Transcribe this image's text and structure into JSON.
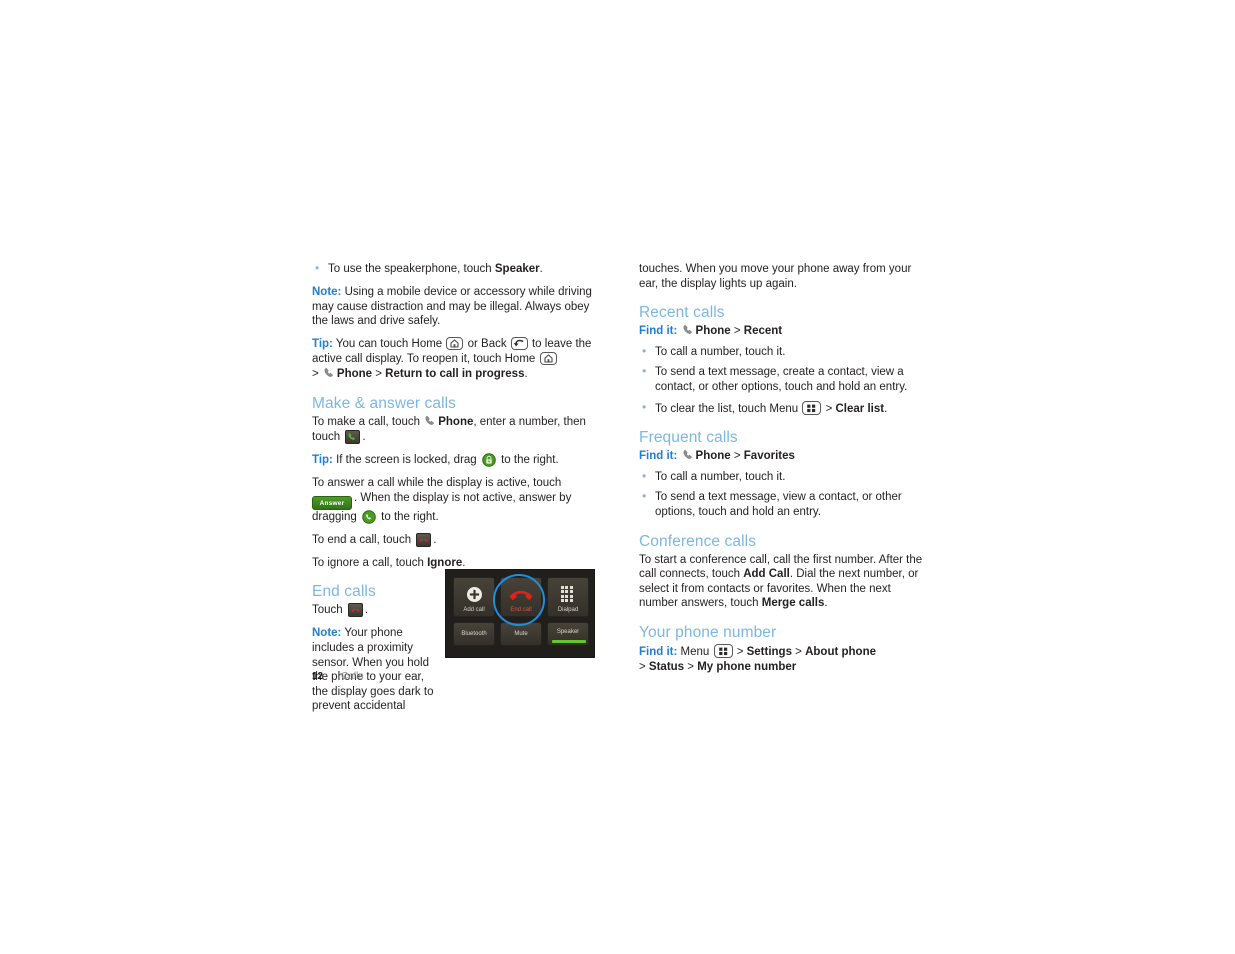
{
  "document": {
    "page_number": "12",
    "section_name": "Calls",
    "accent_heading_color": "#7cb7e2",
    "accent_label_color": "#1f7fd0"
  },
  "left_column": {
    "bullet_speakerphone": {
      "pre": "To use the speakerphone, touch ",
      "bold": "Speaker",
      "post": "."
    },
    "note_driving": {
      "label": "Note:",
      "text": " Using a mobile device or accessory while driving may cause distraction and may be illegal. Always obey the laws and drive safely."
    },
    "tip_home_back": {
      "label": "Tip:",
      "t1": " You can touch Home ",
      "t2": " or Back ",
      "t3": " to leave the active call display. To reopen it, touch Home ",
      "t4": "> ",
      "bold_phone": "Phone",
      "gt": " > ",
      "bold_return": "Return to call in progress",
      "period": "."
    },
    "heading_make_answer": "Make & answer calls",
    "make_call": {
      "pre": "To make a call, touch ",
      "bold_phone": "Phone",
      "mid": ", enter a number, then touch ",
      "post": "."
    },
    "tip_locked": {
      "label": "Tip:",
      "pre": " If the screen is locked, drag ",
      "post": " to the right."
    },
    "answer_call": {
      "pre": "To answer a call while the display is active, touch ",
      "answer_button_label": "Answer",
      "mid": ". When the display is not active, answer by dragging ",
      "post": " to the right."
    },
    "end_call_line": {
      "pre": "To end a call, touch ",
      "post": "."
    },
    "ignore_call_line": {
      "pre": "To ignore a call, touch ",
      "bold": "Ignore",
      "post": "."
    },
    "heading_end_calls": "End calls",
    "touch_line": {
      "pre": "Touch ",
      "post": "."
    },
    "note_proximity": {
      "label": "Note:",
      "text": " Your phone includes a proximity sensor. When you hold the phone to your ear, the display goes dark to prevent accidental"
    }
  },
  "phone_screenshot": {
    "buttons": [
      {
        "name": "add-call",
        "label": "Add call"
      },
      {
        "name": "end-call",
        "label": "End call"
      },
      {
        "name": "dialpad",
        "label": "Dialpad"
      },
      {
        "name": "bluetooth",
        "label": "Bluetooth"
      },
      {
        "name": "mute",
        "label": "Mute"
      },
      {
        "name": "speaker",
        "label": "Speaker"
      }
    ],
    "highlighted_button": "End call",
    "highlight_color": "#1e8fe0",
    "active_indicator_button": "Speaker",
    "active_indicator_color": "#6ac62e",
    "end_call_glyph_color": "#d8282a"
  },
  "right_column": {
    "continued_text": "touches. When you move your phone away from your ear, the display lights up again.",
    "recent_calls": {
      "heading": "Recent calls",
      "findit_label": "Find it:",
      "findit_bold1": "Phone",
      "findit_gt": " > ",
      "findit_bold2": "Recent",
      "bullets": [
        "To call a number, touch it.",
        "To send a text message, create a contact, view a contact, or other options, touch and hold an entry."
      ],
      "bullet_clear": {
        "pre": "To clear the list, touch Menu ",
        "gt": " > ",
        "bold": "Clear list",
        "post": "."
      }
    },
    "frequent_calls": {
      "heading": "Frequent calls",
      "findit_label": "Find it:",
      "findit_bold1": "Phone",
      "findit_gt": " > ",
      "findit_bold2": "Favorites",
      "bullets": [
        "To call a number, touch it.",
        "To send a text message, view a contact, or other options, touch and hold an entry."
      ]
    },
    "conference_calls": {
      "heading": "Conference calls",
      "p1": "To start a conference call, call the first number. After the call connects, touch ",
      "bold1": "Add Call",
      "p2": ". Dial the next number, or select it from contacts or favorites. When the next number answers, touch ",
      "bold2": "Merge calls",
      "p3": "."
    },
    "your_phone_number": {
      "heading": "Your phone number",
      "findit_label": "Find it:",
      "menu_word": "Menu ",
      "gt1": " > ",
      "bold1": "Settings",
      "gt2": " > ",
      "bold2": "About phone",
      "line2_gt": "> ",
      "bold3": "Status",
      "gt3": " > ",
      "bold4": "My phone number"
    }
  },
  "icons": {
    "home": "home-key-icon",
    "back": "back-key-icon",
    "menu": "menu-key-icon",
    "handset": "phone-handset-icon",
    "green_phone_button": "green-phone-button-icon",
    "red_endcall_button": "red-endcall-button-icon",
    "lock": "green-lock-icon",
    "answer_circle": "green-answer-circle-icon"
  }
}
